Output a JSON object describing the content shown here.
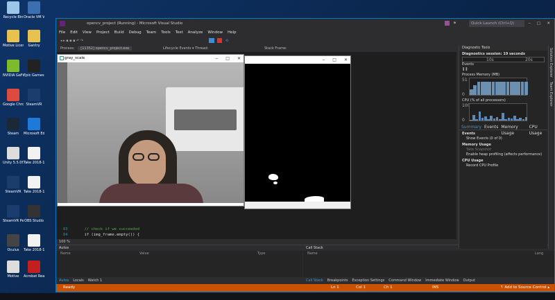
{
  "desktop": {
    "icons": [
      {
        "label": "Recycle Bin",
        "color": "#9cc7e8"
      },
      {
        "label": "Oracle VM VirtualBox",
        "color": "#3b6fb0"
      },
      {
        "label": "Motive Licens...",
        "color": "#e7c24f"
      },
      {
        "label": "Gantry",
        "color": "#e7c24f"
      },
      {
        "label": "NVIDIA GeForce Experience",
        "color": "#7dbb2a"
      },
      {
        "label": "Epic Games Launcher",
        "color": "#222"
      },
      {
        "label": "Google Chrome",
        "color": "#dd4b3e"
      },
      {
        "label": "SteamVR",
        "color": "#1b3d6e"
      },
      {
        "label": "Steam",
        "color": "#1b2838"
      },
      {
        "label": "Microsoft Edge",
        "color": "#1e7ad9"
      },
      {
        "label": "Unity 5.5.0f3 (64-bit)",
        "color": "#ddd"
      },
      {
        "label": "Take 2018-10...",
        "color": "#f2f2f2"
      },
      {
        "label": "SteamVR",
        "color": "#1b3d6e"
      },
      {
        "label": "Take 2018-10...",
        "color": "#f2f2f2"
      },
      {
        "label": "SteamVR Performan...",
        "color": "#1b3d6e"
      },
      {
        "label": "OBS Studio",
        "color": "#333"
      },
      {
        "label": "Oculus",
        "color": "#444"
      },
      {
        "label": "Take 2018-10...",
        "color": "#f2f2f2"
      },
      {
        "label": "Motive",
        "color": "#ddd"
      },
      {
        "label": "Acrobat Reader DC",
        "color": "#c1201f"
      },
      {
        "label": "mocap",
        "color": "#e7c24f"
      },
      {
        "label": "RoboPlus",
        "color": "#3d77c8"
      }
    ]
  },
  "vs": {
    "title": "opencv_project (Running) - Microsoft Visual Studio",
    "quick_launch": "Quick Launch (Ctrl+Q)",
    "menu": [
      "File",
      "Edit",
      "View",
      "Project",
      "Build",
      "Debug",
      "Team",
      "Tools",
      "Test",
      "Analyze",
      "Window",
      "Help"
    ],
    "process_label": "Process:",
    "process_value": "[11352] opencv_project.exe",
    "lifecycle": "Lifecycle Events ▾  Thread:",
    "stack_frame": "Stack Frame:",
    "zoom": "100 %",
    "code": [
      {
        "ln": "83",
        "text": "// check if we succeeded"
      },
      {
        "ln": "84",
        "text": "if (img_frame.empty()) {"
      }
    ],
    "autos": {
      "title": "Autos",
      "cols": [
        "Name",
        "Value",
        "Type"
      ],
      "tabs": [
        "Autos",
        "Locals",
        "Watch 1"
      ]
    },
    "callstack": {
      "title": "Call Stack",
      "cols": [
        "Name",
        "Lang"
      ],
      "tabs": [
        "Call Stack",
        "Breakpoints",
        "Exception Settings",
        "Command Window",
        "Immediate Window",
        "Output"
      ]
    },
    "diag": {
      "title": "Diagnostic Tools",
      "session": "Diagnostics session: 19 seconds",
      "ticks": [
        "10s",
        "20s"
      ],
      "events": "Events",
      "memory": "Process Memory (MB)",
      "mem_max": "51",
      "mem_min": "0",
      "cpu": "CPU (% of all processors)",
      "cpu_max": "100",
      "cpu_min": "0",
      "tabs": [
        "Summary",
        "Events",
        "Memory Usage",
        "CPU Usage"
      ],
      "events_hdr": "Events",
      "show_events": "Show Events (0 of 0)",
      "mem_usage": "Memory Usage",
      "take_snapshot": "Take Snapshot",
      "heap": "Enable heap profiling (affects performance)",
      "cpu_usage": "CPU Usage",
      "record": "Record CPU Profile",
      "memory_samples": [
        0.35,
        0.6,
        0.78,
        0.8,
        0.79,
        0.8,
        0.81,
        0.8,
        0.8,
        0.81,
        0.8,
        0.8,
        0.8,
        0.81,
        0.8,
        0.8
      ],
      "cpu_samples": [
        0.05,
        0.35,
        0.1,
        0.55,
        0.15,
        0.25,
        0.08,
        0.3,
        0.12,
        0.2,
        0.1,
        0.45,
        0.1,
        0.18,
        0.12,
        0.28,
        0.08,
        0.15,
        0.1,
        0.22
      ]
    },
    "side_tabs": [
      "Solution Explorer",
      "Team Explorer"
    ],
    "status": {
      "ready": "Ready",
      "ln": "Ln 1",
      "col": "Col 1",
      "ch": "Ch 1",
      "ins": "INS",
      "source": "↑ Add to Source Control ▴"
    }
  },
  "cvwin1": {
    "title": "gray_scale"
  },
  "cvwin2": {
    "title": ""
  }
}
